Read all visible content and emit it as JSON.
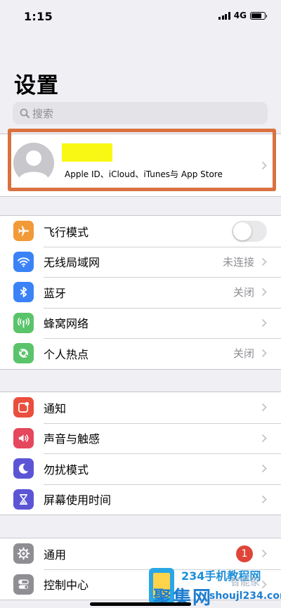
{
  "status_bar": {
    "time": "1:15",
    "network": "4G"
  },
  "page_title": "设置",
  "search": {
    "placeholder": "搜索"
  },
  "profile": {
    "subtitle": "Apple ID、iCloud、iTunes与 App Store"
  },
  "groups": [
    {
      "items": [
        {
          "label": "飞行模式",
          "icon": "airplane-icon",
          "icon_color": "#f19a37",
          "control": "toggle",
          "toggle_on": false
        },
        {
          "label": "无线局域网",
          "icon": "wifi-icon",
          "icon_color": "#3a82f6",
          "value": "未连接"
        },
        {
          "label": "蓝牙",
          "icon": "bluetooth-icon",
          "icon_color": "#3a82f6",
          "value": "关闭"
        },
        {
          "label": "蜂窝网络",
          "icon": "cellular-icon",
          "icon_color": "#5ac46a",
          "value": ""
        },
        {
          "label": "个人热点",
          "icon": "hotspot-icon",
          "icon_color": "#5ac46a",
          "value": "关闭"
        }
      ]
    },
    {
      "items": [
        {
          "label": "通知",
          "icon": "notifications-icon",
          "icon_color": "#ea4e3d"
        },
        {
          "label": "声音与触感",
          "icon": "sound-icon",
          "icon_color": "#e5475d"
        },
        {
          "label": "勿扰模式",
          "icon": "moon-icon",
          "icon_color": "#5b55d6"
        },
        {
          "label": "屏幕使用时间",
          "icon": "hourglass-icon",
          "icon_color": "#5b55d6"
        }
      ]
    },
    {
      "items": [
        {
          "label": "通用",
          "icon": "gear-icon",
          "icon_color": "#8e8e93",
          "badge": "1"
        },
        {
          "label": "控制中心",
          "icon": "control-center-icon",
          "icon_color": "#8e8e93"
        }
      ]
    }
  ],
  "watermark": {
    "title": "234手机教程网",
    "brand": "聚集网",
    "side": "智能家",
    "url": "shoujl234.com"
  }
}
